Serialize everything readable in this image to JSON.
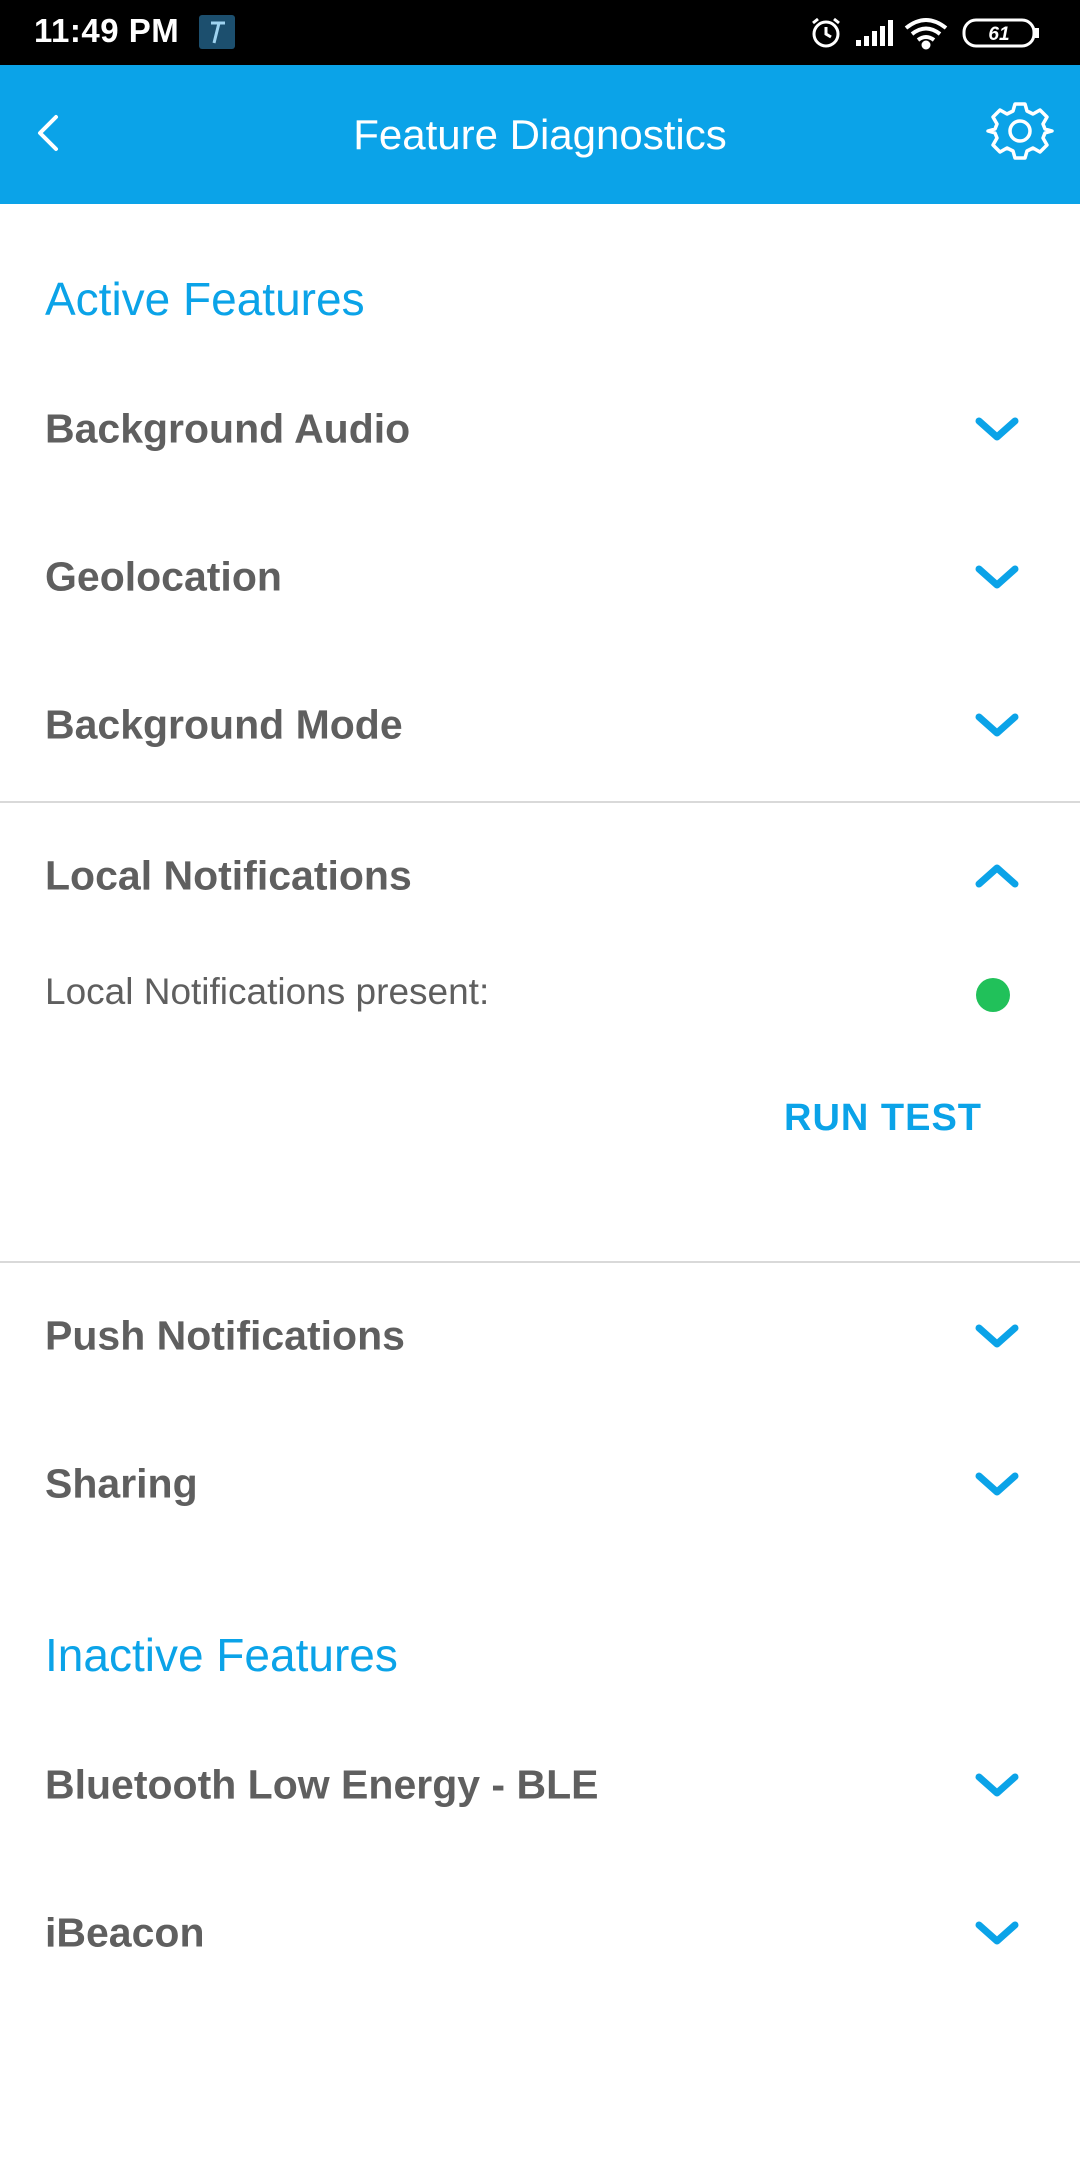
{
  "status_bar": {
    "time": "11:49 PM",
    "battery": "61",
    "icons": [
      "alarm-icon",
      "signal-icon",
      "wifi-icon",
      "battery-icon"
    ]
  },
  "app_bar": {
    "title": "Feature Diagnostics",
    "back_icon": "chevron-left-icon",
    "settings_icon": "gear-icon"
  },
  "colors": {
    "accent": "#0ba3e8",
    "text": "#5f5f5f",
    "status_ok": "#21c15a",
    "divider": "#d9d9d9"
  },
  "active": {
    "title": "Active Features",
    "items": [
      {
        "label": "Background Audio"
      },
      {
        "label": "Geolocation"
      },
      {
        "label": "Background Mode"
      },
      {
        "label": "Local Notifications",
        "expanded": true,
        "detail": {
          "label": "Local Notifications present:",
          "status": "ok",
          "action": "RUN TEST"
        }
      },
      {
        "label": "Push Notifications"
      },
      {
        "label": "Sharing"
      }
    ]
  },
  "inactive": {
    "title": "Inactive Features",
    "items": [
      {
        "label": "Bluetooth Low Energy - BLE"
      },
      {
        "label": "iBeacon"
      }
    ]
  }
}
